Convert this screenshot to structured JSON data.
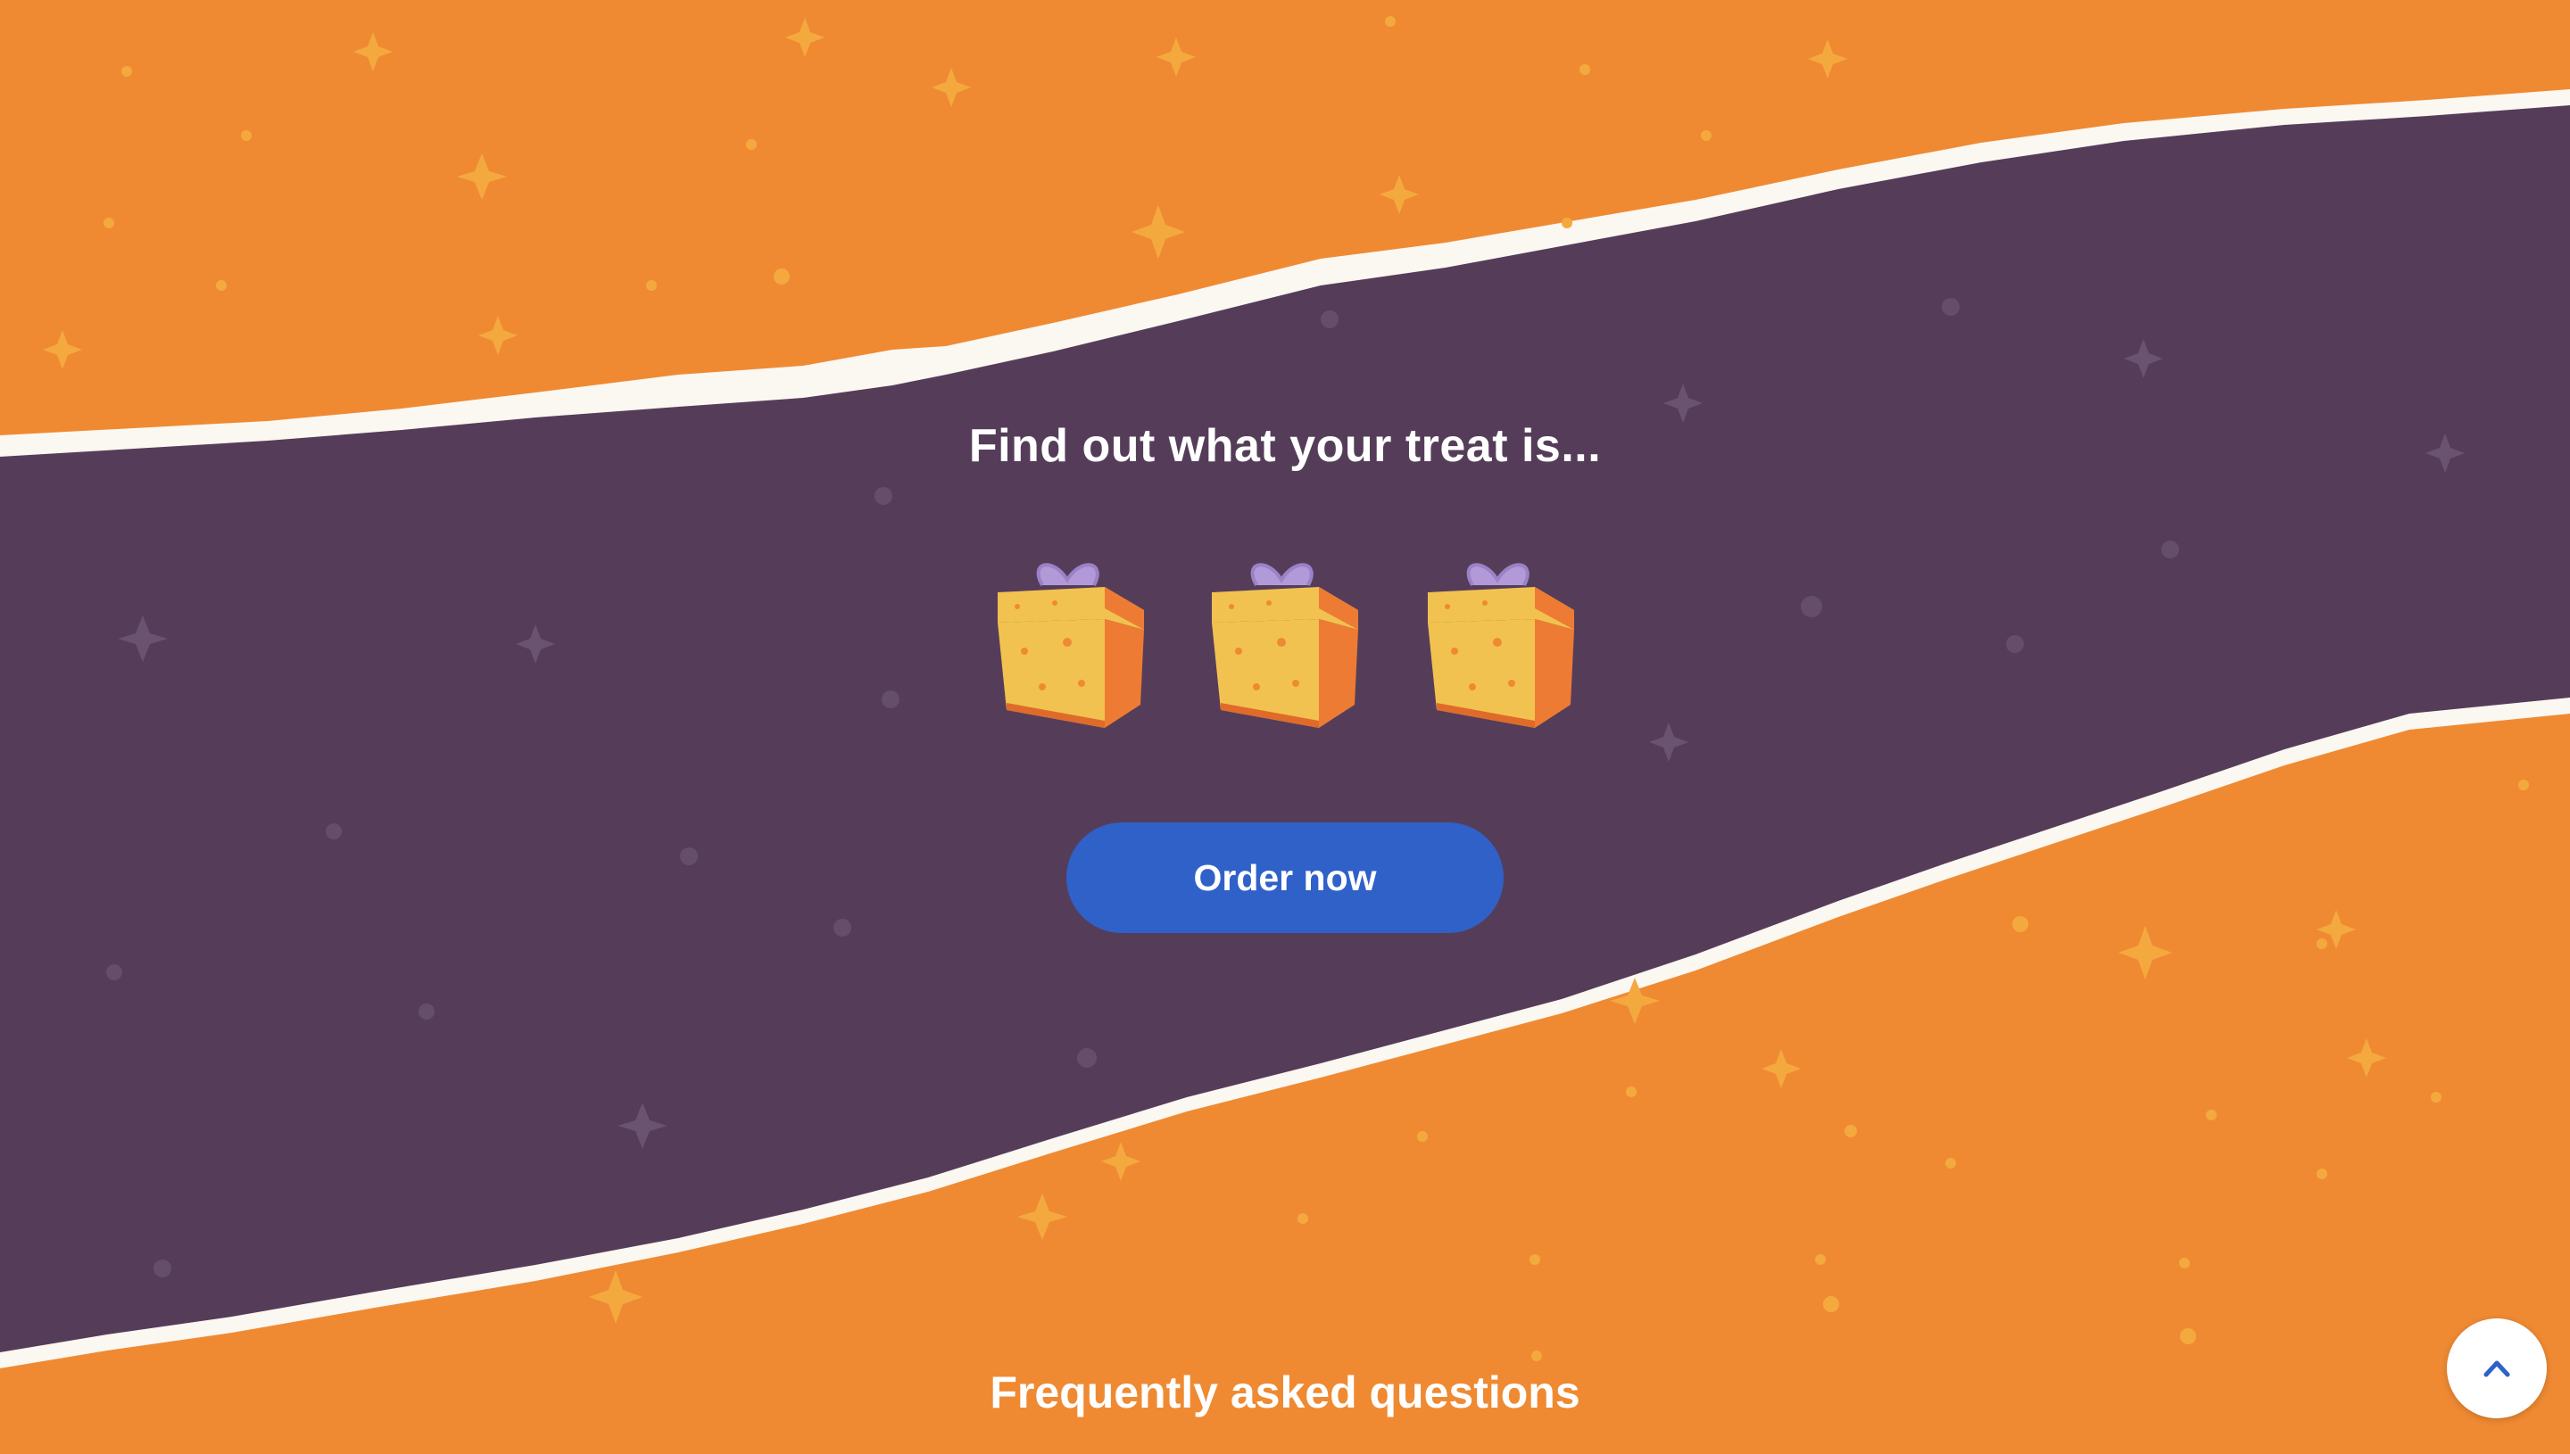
{
  "promo": {
    "title": "Find out what your treat is...",
    "gifts": [
      {
        "icon": "gift-box-icon"
      },
      {
        "icon": "gift-box-icon"
      },
      {
        "icon": "gift-box-icon"
      }
    ],
    "cta_label": "Order now"
  },
  "faq": {
    "title": "Frequently asked questions"
  },
  "scroll_top": {
    "icon": "chevron-up-icon"
  },
  "colors": {
    "orange_bg": "#ef8a33",
    "purple_band": "#553d5a",
    "cta_blue": "#2f61c9",
    "white": "#ffffff",
    "gift_yellow": "#f1c24f",
    "gift_orange": "#ee7b33",
    "ribbon_lavender": "#b29ad8"
  }
}
